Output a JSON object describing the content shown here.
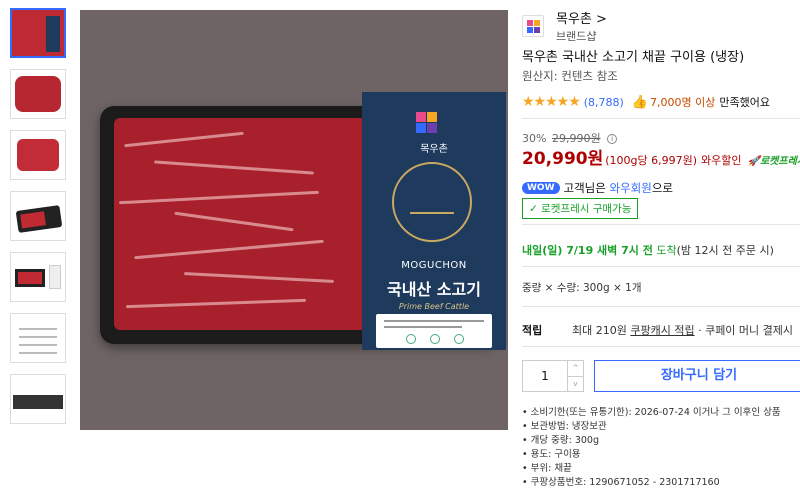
{
  "thumbnails": [
    {
      "name": "thumb-1",
      "active": true
    },
    {
      "name": "thumb-2"
    },
    {
      "name": "thumb-3"
    },
    {
      "name": "thumb-4"
    },
    {
      "name": "thumb-5"
    },
    {
      "name": "thumb-6"
    },
    {
      "name": "thumb-7"
    }
  ],
  "packaging": {
    "brand": "목우촌",
    "english_name": "MOGUCHON",
    "korean_name": "국내산 소고기",
    "subtitle": "Prime Beef Cattle"
  },
  "brand": {
    "name": "목우촌 >",
    "shop_label": "브랜드샵"
  },
  "product": {
    "title": "목우촌 국내산 소고기 채끝 구이용 (냉장)",
    "origin": "원산지: 컨텐츠 참조"
  },
  "rating": {
    "stars": "★★★★★",
    "review_count": "(8,788)",
    "satisfied_count": "7,000명 이상",
    "satisfied_text": "만족했어요"
  },
  "pricing": {
    "discount_rate": "30%",
    "original_price": "29,990원",
    "price": "20,990원",
    "unit_price": "(100g당 6,997원)",
    "wow_discount": "와우할인",
    "rocket_fresh": "로켓프레시"
  },
  "wow": {
    "badge": "WOW",
    "text_prefix": "고객님은",
    "link": "와우회원",
    "text_suffix": "으로"
  },
  "rocket_badge": "✓ 로켓프레시 구매가능",
  "delivery": {
    "date": "내일(일) 7/19 새벽 7시 전",
    "arrive": "도착",
    "note": "(밤 12시 전 주문 시)"
  },
  "option": "중량 × 수량: 300g × 1개",
  "cash": {
    "label": "적립",
    "text_prefix": "최대 210원",
    "link": "쿠팡캐시 적립",
    "text_suffix": "· 쿠페이 머니 결제시"
  },
  "quantity": {
    "value": "1",
    "up": "^",
    "down": "v"
  },
  "cart_button": "장바구니 담기",
  "details": [
    "소비기한(또는 유통기한): 2026-07-24 이거나 그 이후인 상품",
    "보관방법: 냉장보관",
    "개당 중량: 300g",
    "용도: 구이용",
    "부위: 채끝",
    "쿠팡상품번호: 1290671052 - 2301717160"
  ],
  "colors": {
    "accent": "#346aff",
    "price": "#ae0000",
    "rocket": "#19a02a",
    "star": "#f5a623"
  }
}
